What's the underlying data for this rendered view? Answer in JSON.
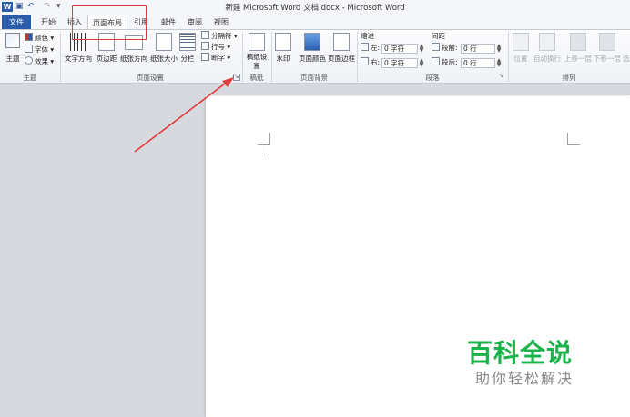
{
  "window": {
    "title": "新建 Microsoft Word 文档.docx - Microsoft Word"
  },
  "quick_access": [
    {
      "name": "word-logo-icon"
    },
    {
      "name": "save-icon"
    },
    {
      "name": "undo-icon"
    },
    {
      "name": "redo-icon"
    },
    {
      "name": "customize-qat-icon"
    }
  ],
  "tabs": [
    "文件",
    "开始",
    "插入",
    "页面布局",
    "引用",
    "邮件",
    "审阅",
    "视图"
  ],
  "active_tab": "页面布局",
  "ribbon": {
    "themes": {
      "label": "主题",
      "theme_button": "主题",
      "colors": "颜色",
      "fonts": "字体",
      "effects": "效果"
    },
    "page_setup": {
      "label": "页面设置",
      "text_direction": "文字方向",
      "margins": "页边距",
      "orientation": "纸张方向",
      "size": "纸张大小",
      "columns": "分栏",
      "breaks": "分隔符",
      "line_numbers": "行号",
      "hyphenation": "断字"
    },
    "manuscript": {
      "label": "稿纸",
      "settings": "稿纸设置"
    },
    "page_background": {
      "label": "页面背景",
      "watermark": "水印",
      "page_color": "页面颜色",
      "page_borders": "页面边框"
    },
    "paragraph": {
      "label": "段落",
      "indent_title": "缩进",
      "spacing_title": "间距",
      "indent_left_label": "左:",
      "indent_left_value": "0 字符",
      "indent_right_label": "右:",
      "indent_right_value": "0 字符",
      "space_before_label": "段前:",
      "space_before_value": "0 行",
      "space_after_label": "段后:",
      "space_after_value": "0 行"
    },
    "arrange": {
      "label": "排列",
      "position": "位置",
      "wrap_text": "自动换行",
      "bring_forward": "上移一层",
      "send_backward": "下移一层",
      "selection_pane": "选"
    }
  },
  "watermark": {
    "title": "百科全说",
    "subtitle": "助你轻松解决"
  },
  "colors": {
    "file_tab": "#2b5caa",
    "highlight": "#e23b3b",
    "watermark_green": "#19b24b"
  }
}
